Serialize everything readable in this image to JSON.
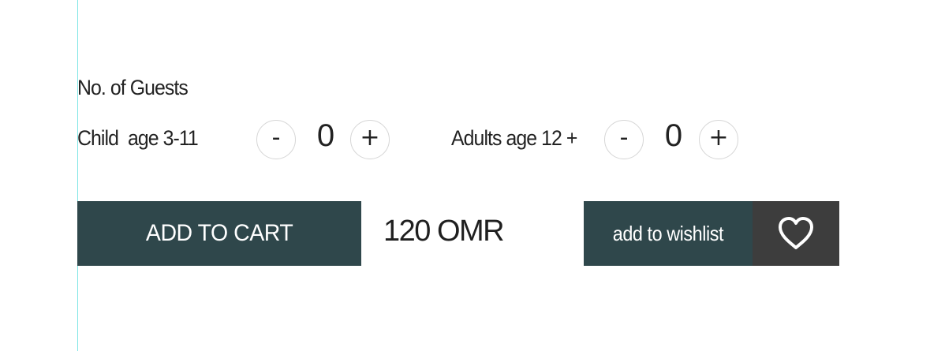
{
  "guests": {
    "title": "No. of Guests",
    "child": {
      "label": "Child  age 3-11",
      "decrement": "-",
      "count": "0",
      "increment": "+"
    },
    "adults": {
      "label": "Adults age 12 +",
      "decrement": "-",
      "count": "0",
      "increment": "+"
    }
  },
  "cart": {
    "button_label": "ADD TO CART",
    "price": "120 OMR"
  },
  "wishlist": {
    "label": "add to wishlist",
    "icon": "heart-icon"
  },
  "colors": {
    "primary_dark": "#2f474b",
    "heart_bg": "#3d3d3d",
    "guide_line": "#7fe6e6"
  }
}
